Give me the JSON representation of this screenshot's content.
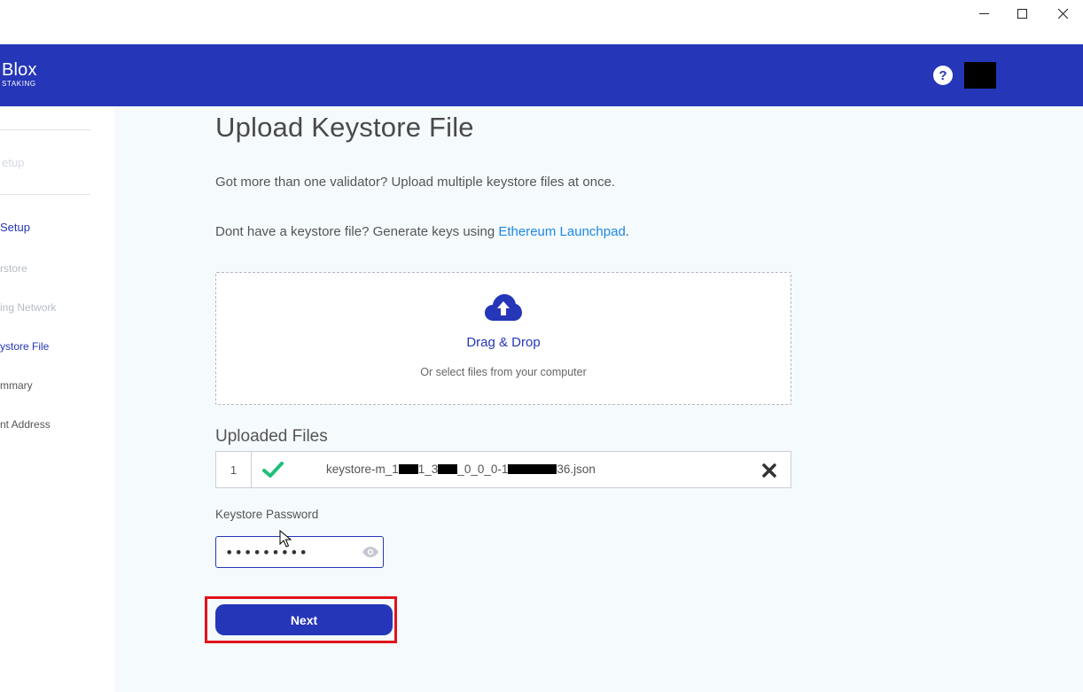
{
  "window": {
    "minimize_label": "—",
    "maximize_label": "☐",
    "close_label": "✕"
  },
  "header": {
    "brand": "Blox",
    "brand_sub": "STAKING",
    "help_label": "?",
    "accent": "#2536b8"
  },
  "sidebar": {
    "items": [
      {
        "label": "etup"
      },
      {
        "label": "Setup"
      },
      {
        "label": "rstore"
      },
      {
        "label": "ing Network"
      },
      {
        "label": "ystore File"
      },
      {
        "label": "mmary"
      },
      {
        "label": "nt Address"
      }
    ]
  },
  "main": {
    "title": "Upload Keystore File",
    "desc1": "Got more than one validator? Upload multiple keystore files at once.",
    "desc2_prefix": "Dont have a keystore file? Generate keys using ",
    "desc2_link": "Ethereum Launchpad",
    "desc2_suffix": ".",
    "dropzone": {
      "title": "Drag & Drop",
      "subtitle": "Or select files from your computer",
      "icon": "cloud-upload-icon"
    },
    "uploaded": {
      "title": "Uploaded Files",
      "files": [
        {
          "index": "1",
          "name_parts": [
            "keystore-m_1",
            "1_3",
            "_0_0_0-1",
            "36.json"
          ],
          "status_icon": "check-icon"
        }
      ]
    },
    "password": {
      "label": "Keystore Password",
      "value": "•••••••••"
    },
    "next_label": "Next"
  }
}
